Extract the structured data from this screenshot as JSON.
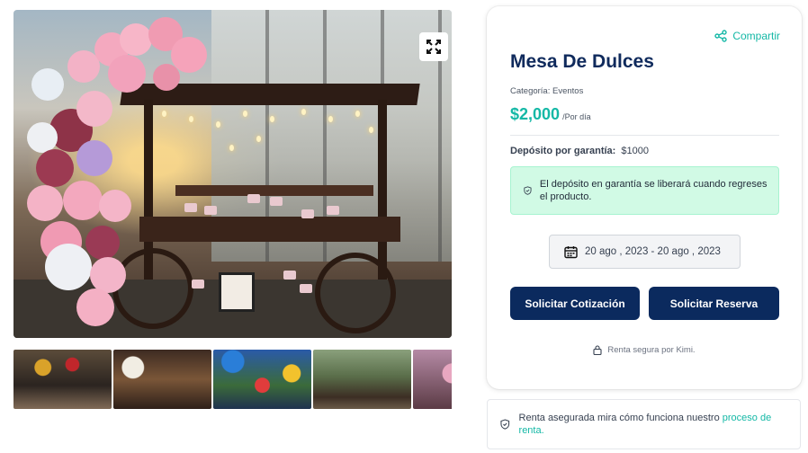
{
  "gallery": {
    "main_image_alt": "Mesa De Dulces",
    "expand_icon": "expand-icon",
    "thumbnails": [
      "thumbnail-1",
      "thumbnail-2",
      "thumbnail-3",
      "thumbnail-4",
      "thumbnail-5"
    ]
  },
  "product": {
    "share_label": "Compartir",
    "share_icon": "share-icon",
    "title": "Mesa De Dulces",
    "category": "Categoría: Eventos",
    "price": "$2,000",
    "price_unit": "/Por día",
    "deposit_label": "Depósito por garantía:",
    "deposit_value": "$1000",
    "deposit_notice": "El depósito en garantía se liberará cuando regreses el producto.",
    "date_range": "20 ago , 2023 - 20 ago , 2023",
    "quote_button": "Solicitar Cotización",
    "reserve_button": "Solicitar Reserva",
    "secure_text": "Renta segura por Kimi."
  },
  "bottom_notice": {
    "text": "Renta asegurada mira cómo funciona nuestro ",
    "link": "proceso de renta."
  },
  "colors": {
    "accent": "#14b8a6",
    "primary": "#0b2a5e",
    "notice_bg": "#d1fae5"
  }
}
